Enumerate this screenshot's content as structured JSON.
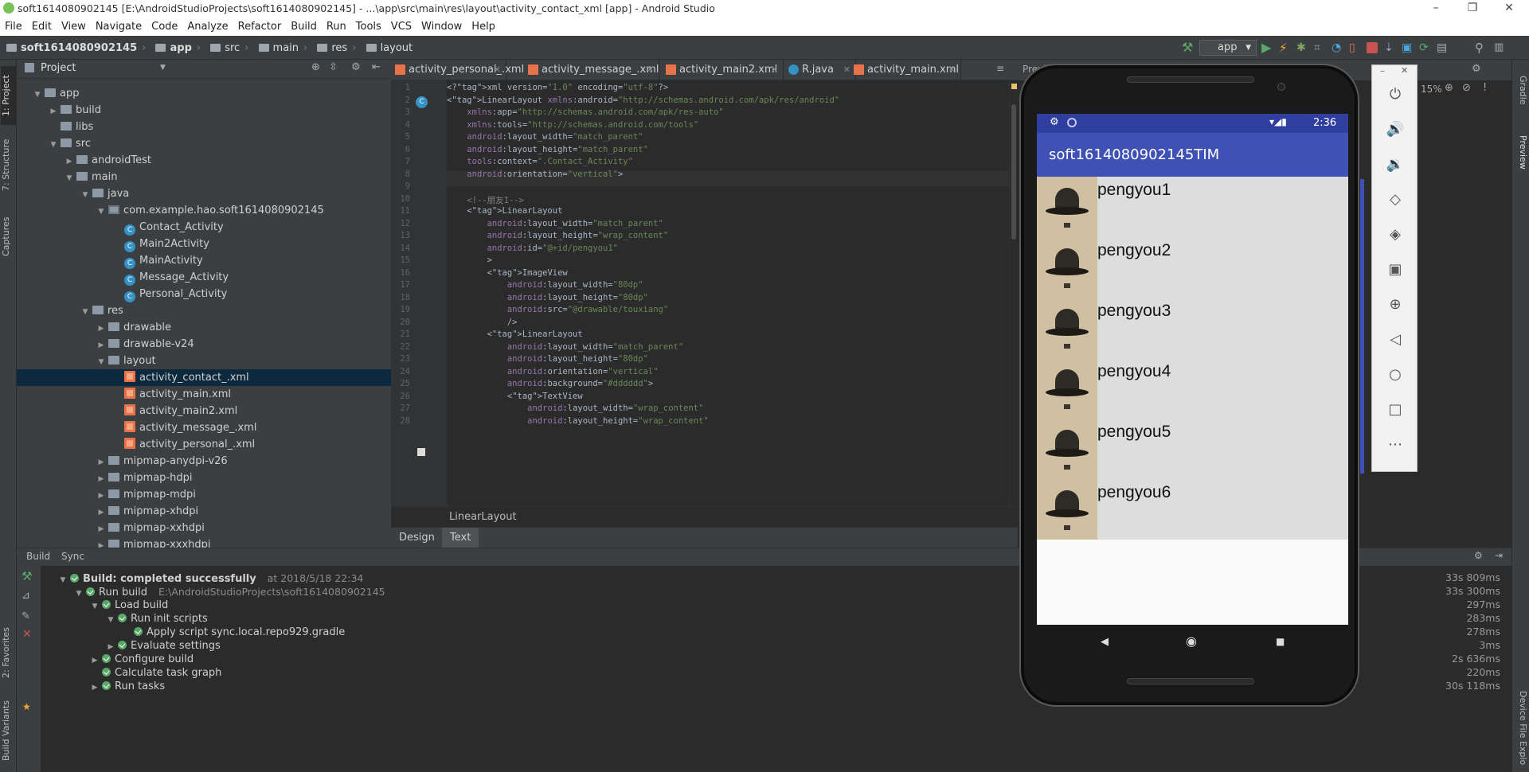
{
  "window": {
    "title": "soft1614080902145 [E:\\AndroidStudioProjects\\soft1614080902145] - ...\\app\\src\\main\\res\\layout\\activity_contact_xml [app] - Android Studio",
    "controls": [
      "–",
      "❐",
      "✕"
    ]
  },
  "menu": [
    "File",
    "Edit",
    "View",
    "Navigate",
    "Code",
    "Analyze",
    "Refactor",
    "Build",
    "Run",
    "Tools",
    "VCS",
    "Window",
    "Help"
  ],
  "breadcrumb": [
    "soft1614080902145",
    "app",
    "src",
    "main",
    "res",
    "layout"
  ],
  "run_config": "app",
  "left_strip": {
    "project": "1: Project",
    "structure": "7: Structure",
    "captures": "Captures",
    "favorites": "2: Favorites",
    "build_variants": "Build Variants"
  },
  "right_strip": {
    "gradle": "Gradle",
    "preview": "Preview",
    "device_file": "Device File Explo"
  },
  "project_panel": {
    "title": "Project",
    "tree": [
      {
        "label": "app",
        "depth": 0,
        "arrow": "down",
        "icon": "folder"
      },
      {
        "label": "build",
        "depth": 1,
        "arrow": "right",
        "icon": "folder"
      },
      {
        "label": "libs",
        "depth": 1,
        "arrow": "",
        "icon": "folder"
      },
      {
        "label": "src",
        "depth": 1,
        "arrow": "down",
        "icon": "folder"
      },
      {
        "label": "androidTest",
        "depth": 2,
        "arrow": "right",
        "icon": "folder"
      },
      {
        "label": "main",
        "depth": 2,
        "arrow": "down",
        "icon": "folder"
      },
      {
        "label": "java",
        "depth": 3,
        "arrow": "down",
        "icon": "folder"
      },
      {
        "label": "com.example.hao.soft1614080902145",
        "depth": 4,
        "arrow": "down",
        "icon": "package"
      },
      {
        "label": "Contact_Activity",
        "depth": 5,
        "arrow": "",
        "icon": "class"
      },
      {
        "label": "Main2Activity",
        "depth": 5,
        "arrow": "",
        "icon": "class"
      },
      {
        "label": "MainActivity",
        "depth": 5,
        "arrow": "",
        "icon": "class"
      },
      {
        "label": "Message_Activity",
        "depth": 5,
        "arrow": "",
        "icon": "class"
      },
      {
        "label": "Personal_Activity",
        "depth": 5,
        "arrow": "",
        "icon": "class"
      },
      {
        "label": "res",
        "depth": 3,
        "arrow": "down",
        "icon": "folder"
      },
      {
        "label": "drawable",
        "depth": 4,
        "arrow": "right",
        "icon": "folder"
      },
      {
        "label": "drawable-v24",
        "depth": 4,
        "arrow": "right",
        "icon": "folder"
      },
      {
        "label": "layout",
        "depth": 4,
        "arrow": "down",
        "icon": "folder"
      },
      {
        "label": "activity_contact_.xml",
        "depth": 5,
        "arrow": "",
        "icon": "xml",
        "selected": true
      },
      {
        "label": "activity_main.xml",
        "depth": 5,
        "arrow": "",
        "icon": "xml"
      },
      {
        "label": "activity_main2.xml",
        "depth": 5,
        "arrow": "",
        "icon": "xml"
      },
      {
        "label": "activity_message_.xml",
        "depth": 5,
        "arrow": "",
        "icon": "xml"
      },
      {
        "label": "activity_personal_.xml",
        "depth": 5,
        "arrow": "",
        "icon": "xml"
      },
      {
        "label": "mipmap-anydpi-v26",
        "depth": 4,
        "arrow": "right",
        "icon": "folder"
      },
      {
        "label": "mipmap-hdpi",
        "depth": 4,
        "arrow": "right",
        "icon": "folder"
      },
      {
        "label": "mipmap-mdpi",
        "depth": 4,
        "arrow": "right",
        "icon": "folder"
      },
      {
        "label": "mipmap-xhdpi",
        "depth": 4,
        "arrow": "right",
        "icon": "folder"
      },
      {
        "label": "mipmap-xxhdpi",
        "depth": 4,
        "arrow": "right",
        "icon": "folder"
      },
      {
        "label": "mipmap-xxxhdpi",
        "depth": 4,
        "arrow": "right",
        "icon": "folder"
      }
    ]
  },
  "editor_tabs": [
    {
      "label": "activity_personal_.xml",
      "type": "xml"
    },
    {
      "label": "activity_message_.xml",
      "type": "xml"
    },
    {
      "label": "activity_main2.xml",
      "type": "xml"
    },
    {
      "label": "R.java",
      "type": "class"
    },
    {
      "label": "activity_main.xml",
      "type": "xml"
    }
  ],
  "code_lines": [
    "1",
    "2",
    "3",
    "4",
    "5",
    "6",
    "7",
    "8",
    "9",
    "10",
    "11",
    "12",
    "13",
    "14",
    "15",
    "16",
    "17",
    "18",
    "19",
    "20",
    "21",
    "22",
    "23",
    "24",
    "25",
    "26",
    "27",
    "28"
  ],
  "code_text": [
    "<?xml version=\"1.0\" encoding=\"utf-8\"?>",
    "<LinearLayout xmlns:android=\"http://schemas.android.com/apk/res/android\"",
    "    xmlns:app=\"http://schemas.android.com/apk/res-auto\"",
    "    xmlns:tools=\"http://schemas.android.com/tools\"",
    "    android:layout_width=\"match_parent\"",
    "    android:layout_height=\"match_parent\"",
    "    tools:context=\".Contact_Activity\"",
    "    android:orientation=\"vertical\">",
    "",
    "    <!--朋友1-->",
    "    <LinearLayout",
    "        android:layout_width=\"match_parent\"",
    "        android:layout_height=\"wrap_content\"",
    "        android:id=\"@+id/pengyou1\"",
    "        >",
    "        <ImageView",
    "            android:layout_width=\"80dp\"",
    "            android:layout_height=\"80dp\"",
    "            android:src=\"@drawable/touxiang\"",
    "            />",
    "        <LinearLayout",
    "            android:layout_width=\"match_parent\"",
    "            android:layout_height=\"80dp\"",
    "            android:orientation=\"vertical\"",
    "            android:background=\"#dddddd\">",
    "            <TextView",
    "                android:layout_width=\"wrap_content\"",
    "                android:layout_height=\"wrap_content\""
  ],
  "editor_breadcrumb": "LinearLayout",
  "design_tabs": [
    "Design",
    "Text"
  ],
  "preview_label": "Previ",
  "zoom": "15%",
  "build_panel": {
    "tabs": [
      "Build",
      "Sync"
    ],
    "rows": [
      {
        "text": "Build: completed successfully",
        "extra": "at 2018/5/18 22:34",
        "depth": 0,
        "arrow": "down",
        "time": "33s 809ms"
      },
      {
        "text": "Run build",
        "extra": "E:\\AndroidStudioProjects\\soft1614080902145",
        "depth": 1,
        "arrow": "down",
        "time": "33s 300ms"
      },
      {
        "text": "Load build",
        "extra": "",
        "depth": 2,
        "arrow": "down",
        "time": "297ms"
      },
      {
        "text": "Run init scripts",
        "extra": "",
        "depth": 3,
        "arrow": "down",
        "time": "283ms"
      },
      {
        "text": "Apply script sync.local.repo929.gradle",
        "extra": "",
        "depth": 4,
        "arrow": "",
        "time": "278ms"
      },
      {
        "text": "Evaluate settings",
        "extra": "",
        "depth": 3,
        "arrow": "right",
        "time": "3ms"
      },
      {
        "text": "Configure build",
        "extra": "",
        "depth": 2,
        "arrow": "right",
        "time": "2s 636ms"
      },
      {
        "text": "Calculate task graph",
        "extra": "",
        "depth": 2,
        "arrow": "",
        "time": "220ms"
      },
      {
        "text": "Run tasks",
        "extra": "",
        "depth": 2,
        "arrow": "right",
        "time": "30s 118ms"
      }
    ]
  },
  "phone": {
    "time": "2:36",
    "app_title": "soft1614080902145TIM",
    "friends": [
      "pengyou1",
      "pengyou2",
      "pengyou3",
      "pengyou4",
      "pengyou5",
      "pengyou6"
    ],
    "nav": [
      "◀",
      "◉",
      "■"
    ]
  },
  "emulator_tools": [
    "power-icon",
    "volume-up-icon",
    "volume-down-icon",
    "rotate-left-icon",
    "rotate-right-icon",
    "camera-icon",
    "zoom-icon",
    "back-icon",
    "home-icon",
    "overview-icon",
    "more-icon"
  ],
  "emulator_window": [
    "–",
    "✕"
  ]
}
